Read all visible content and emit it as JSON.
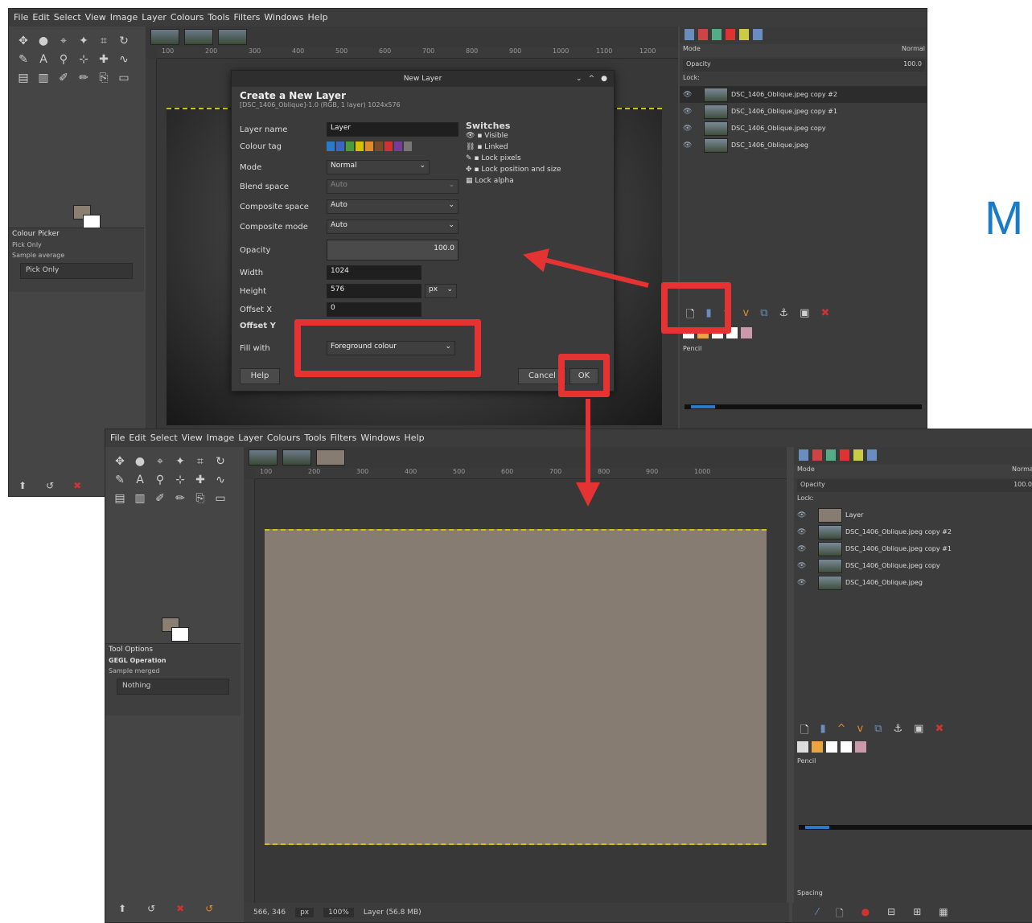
{
  "top_window": {
    "menu": [
      "File",
      "Edit",
      "Select",
      "View",
      "Image",
      "Layer",
      "Colours",
      "Tools",
      "Filters",
      "Windows",
      "Help"
    ],
    "tool_options": {
      "title": "Colour Picker",
      "mode": "Pick Only",
      "sub": "Sample average",
      "select": "Pick Only"
    },
    "ruler_ticks": [
      "100",
      "200",
      "300",
      "400",
      "500",
      "600",
      "700",
      "800",
      "900",
      "1000",
      "1100",
      "1200"
    ],
    "layers_panel": {
      "mode_label": "Mode",
      "mode_value": "Normal",
      "opacity_label": "Opacity",
      "opacity_value": "100.0",
      "lock_label": "Lock:",
      "layers": [
        {
          "name": "DSC_1406_Oblique.jpeg copy #2",
          "selected": true
        },
        {
          "name": "DSC_1406_Oblique.jpeg copy #1",
          "selected": false
        },
        {
          "name": "DSC_1406_Oblique.jpeg copy",
          "selected": false
        },
        {
          "name": "DSC_1406_Oblique.jpeg",
          "selected": false
        }
      ],
      "brush_label": "Pencil"
    }
  },
  "dialog": {
    "window_title": "New Layer",
    "heading": "Create a New Layer",
    "subheading": "[DSC_1406_Oblique]-1.0 (RGB, 1 layer) 1024x576",
    "fields": {
      "layer_name": {
        "label": "Layer name",
        "value": "Layer"
      },
      "color_tag": {
        "label": "Colour tag"
      },
      "mode": {
        "label": "Mode",
        "value": "Normal"
      },
      "blend_space": {
        "label": "Blend space",
        "value": "Auto"
      },
      "composite_space": {
        "label": "Composite space",
        "value": "Auto"
      },
      "composite_mode": {
        "label": "Composite mode",
        "value": "Auto"
      },
      "opacity": {
        "label": "Opacity",
        "value": "100.0"
      },
      "width": {
        "label": "Width",
        "value": "1024"
      },
      "height": {
        "label": "Height",
        "value": "576"
      },
      "unit": "px",
      "offset_x": {
        "label": "Offset X",
        "value": "0"
      },
      "offset_y": {
        "label": "Offset Y"
      },
      "fill_with": {
        "label": "Fill with",
        "value": "Foreground colour"
      }
    },
    "switches": {
      "title": "Switches",
      "items": [
        "Visible",
        "Linked",
        "Lock pixels",
        "Lock position and size",
        "Lock alpha"
      ]
    },
    "help_label": "Help",
    "cancel_label": "Cancel",
    "ok_label": "OK"
  },
  "bottom_window": {
    "menu": [
      "File",
      "Edit",
      "Select",
      "View",
      "Image",
      "Layer",
      "Colours",
      "Tools",
      "Filters",
      "Windows",
      "Help"
    ],
    "tool_options": {
      "title": "Tool Options",
      "mode": "GEGL Operation",
      "sub": "Sample merged",
      "select": "Nothing"
    },
    "ruler_ticks": [
      "100",
      "200",
      "300",
      "400",
      "500",
      "600",
      "700",
      "800",
      "900",
      "1000"
    ],
    "layers_panel": {
      "mode_label": "Mode",
      "mode_value": "Normal",
      "opacity_label": "Opacity",
      "opacity_value": "100.0",
      "lock_label": "Lock:",
      "layers": [
        {
          "name": "Layer",
          "selected": false,
          "fill": true
        },
        {
          "name": "DSC_1406_Oblique.jpeg copy #2",
          "selected": false,
          "fill": false
        },
        {
          "name": "DSC_1406_Oblique.jpeg copy #1",
          "selected": false,
          "fill": false
        },
        {
          "name": "DSC_1406_Oblique.jpeg copy",
          "selected": false,
          "fill": false
        },
        {
          "name": "DSC_1406_Oblique.jpeg",
          "selected": false,
          "fill": false
        }
      ],
      "brush_label": "Pencil",
      "spacing_label": "Spacing"
    },
    "status": {
      "coords": "566, 346",
      "unit": "px",
      "zoom": "100%",
      "info": "Layer (56.8 MB)"
    }
  },
  "annotation_letter": "M",
  "colors": {
    "highlight": "#e53333",
    "fill_colour": "#877c72",
    "accent": "#1a7cc7"
  }
}
